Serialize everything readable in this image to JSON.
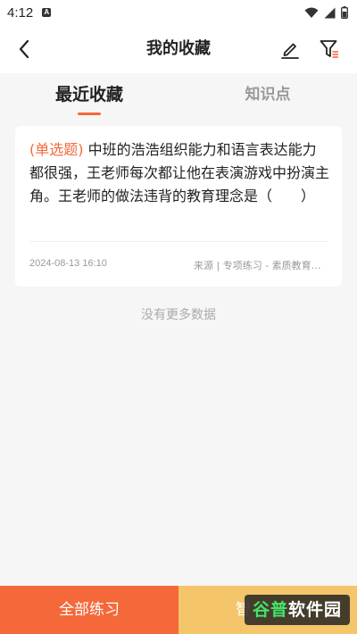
{
  "status_bar": {
    "time": "4:12",
    "app_icon_letter": "A"
  },
  "nav": {
    "title": "我的收藏"
  },
  "tabs": [
    {
      "label": "最近收藏",
      "active": true
    },
    {
      "label": "知识点",
      "active": false
    }
  ],
  "favorites": [
    {
      "type": "(单选题)",
      "question": " 中班的浩浩组织能力和语言表达能力都很强，王老师每次都让他在表演游戏中扮演主角。王老师的做法违背的教育理念是（　　）",
      "date": "2024-08-13  16:10",
      "source": "来源 | 专项练习 - 素质教育理念"
    }
  ],
  "no_more_text": "没有更多数据",
  "bottom": {
    "practice_all": "全部练习",
    "second_partial": "智",
    "watermark_part1": "谷普",
    "watermark_part2": "软件园"
  },
  "colors": {
    "accent": "#f4683a",
    "secondary": "#f4c56a"
  }
}
